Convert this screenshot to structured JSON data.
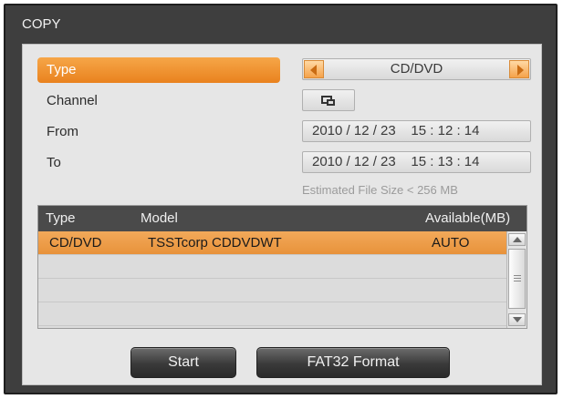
{
  "window": {
    "title": "COPY"
  },
  "form": {
    "type_label": "Type",
    "channel_label": "Channel",
    "from_label": "From",
    "to_label": "To",
    "type_value": "CD/DVD",
    "from_value": "2010 / 12 / 23    15 : 12 : 14",
    "to_value": "2010 / 12 / 23    15 : 13 : 14",
    "estimate": "Estimated File Size < 256 MB"
  },
  "table": {
    "headers": [
      "Type",
      "Model",
      "Available(MB)"
    ],
    "rows": [
      {
        "type": "CD/DVD",
        "model": "TSSTcorp CDDVDWT",
        "available": "AUTO"
      }
    ]
  },
  "buttons": {
    "start": "Start",
    "format": "FAT32 Format"
  },
  "icons": {
    "type_prev": "arrow-left-icon",
    "type_next": "arrow-right-icon",
    "channel": "channel-select-icon",
    "scroll_up": "scroll-up-icon",
    "scroll_down": "scroll-down-icon"
  },
  "colors": {
    "accent": "#e9821e",
    "dialog_bg": "#3e3e3e",
    "panel_bg": "#e6e6e6"
  }
}
